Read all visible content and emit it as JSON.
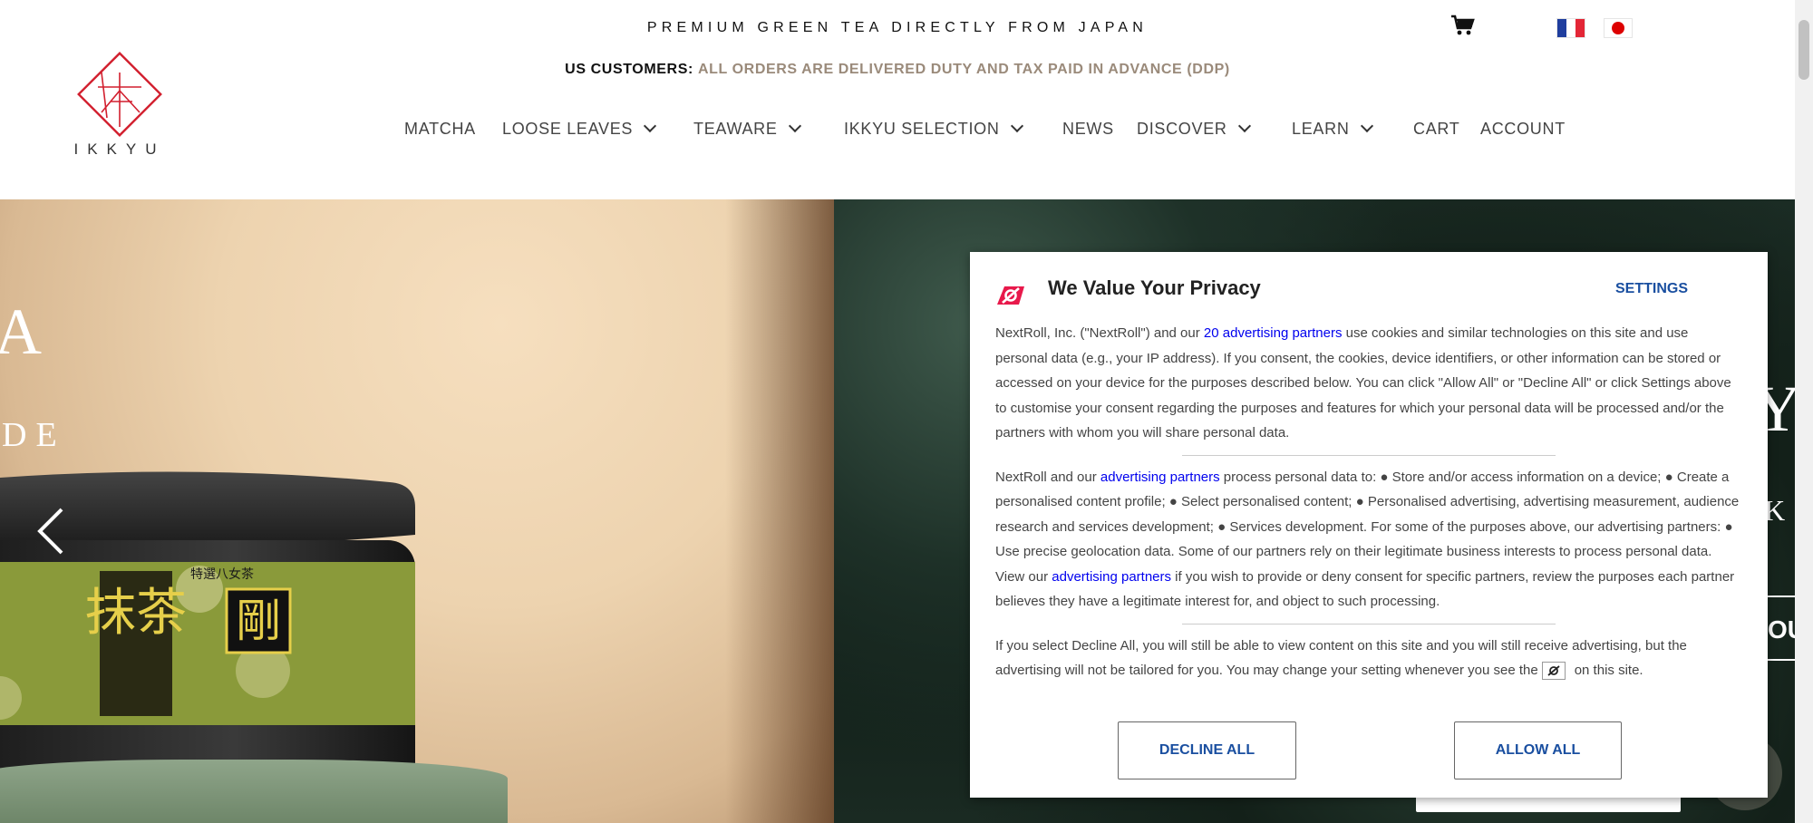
{
  "header": {
    "tagline": "PREMIUM GREEN TEA DIRECTLY FROM JAPAN",
    "duty_label": "US CUSTOMERS:",
    "duty_message": "ALL ORDERS ARE DELIVERED DUTY AND TAX PAID IN ADVANCE (DDP)",
    "logo_text": "IKKYU",
    "cart_icon": "shopping-cart-icon",
    "languages": [
      "fr",
      "jp"
    ]
  },
  "nav": {
    "items": [
      {
        "label": "MATCHA",
        "has_dropdown": false
      },
      {
        "label": "LOOSE LEAVES",
        "has_dropdown": true
      },
      {
        "label": "TEAWARE",
        "has_dropdown": true
      },
      {
        "label": "IKKYU SELECTION",
        "has_dropdown": true
      },
      {
        "label": "NEWS",
        "has_dropdown": false
      },
      {
        "label": "DISCOVER",
        "has_dropdown": true
      },
      {
        "label": "LEARN",
        "has_dropdown": true
      },
      {
        "label": "CART",
        "has_dropdown": false
      },
      {
        "label": "ACCOUNT",
        "has_dropdown": false
      }
    ]
  },
  "hero": {
    "left_partial_title": "A",
    "left_partial_subtitle": "DE",
    "right_partial_title": "Y",
    "right_partial_subtitle": "K",
    "right_partial_button": "OU",
    "product_label_1": "抹茶",
    "product_label_2": "剛",
    "product_label_3": "特選八女茶"
  },
  "consent": {
    "title": "We Value Your Privacy",
    "settings_label": "SETTINGS",
    "para1_pre": "NextRoll, Inc. (\"NextRoll\") and our ",
    "para1_link": "20 advertising partners",
    "para1_post": " use cookies and similar technologies on this site and use personal data (e.g., your IP address). If you consent, the cookies, device identifiers, or other information can be stored or accessed on your device for the purposes described below. You can click \"Allow All\" or \"Decline All\" or click Settings above to customise your consent regarding the purposes and features for which your personal data will be processed and/or the partners with whom you will share personal data.",
    "para2_pre": "NextRoll and our ",
    "para2_link1": "advertising partners",
    "para2_mid": " process personal data to: ● Store and/or access information on a device; ● Create a personalised content profile; ● Select personalised content; ● Personalised advertising, advertising measurement, audience research and services development; ● Services development. For some of the purposes above, our advertising partners: ● Use precise geolocation data. Some of our partners rely on their legitimate business interests to process personal data. View our ",
    "para2_link2": "advertising partners",
    "para2_post": " if you wish to provide or deny consent for specific partners, review the purposes each partner believes they have a legitimate interest for, and object to such processing.",
    "para3_pre": "If you select Decline All, you will still be able to view content on this site and you will still receive advertising, but the advertising will not be tailored for you. You may change your setting whenever you see the",
    "para3_post": "on this site.",
    "decline_label": "DECLINE ALL",
    "allow_label": "ALLOW ALL",
    "brand_color": "#e8194b",
    "button_text_color": "#1a4fa0"
  }
}
